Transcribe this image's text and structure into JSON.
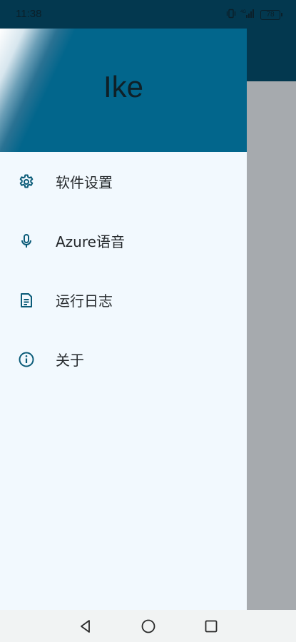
{
  "status_bar": {
    "time": "11:38",
    "battery": "78"
  },
  "drawer": {
    "title": "Ike",
    "items": [
      {
        "label": "软件设置",
        "icon": "gear-icon"
      },
      {
        "label": "Azure语音",
        "icon": "microphone-icon"
      },
      {
        "label": "运行日志",
        "icon": "document-icon"
      },
      {
        "label": "关于",
        "icon": "info-icon"
      }
    ]
  },
  "colors": {
    "status_bar": "#03384f",
    "header": "#02668c",
    "drawer_bg": "#f2f9fe",
    "icon": "#0a5b78",
    "scrim": "#a6aaae",
    "nav_bar": "#f1f3f3"
  },
  "nav": [
    "back-icon",
    "home-icon",
    "recents-icon"
  ]
}
